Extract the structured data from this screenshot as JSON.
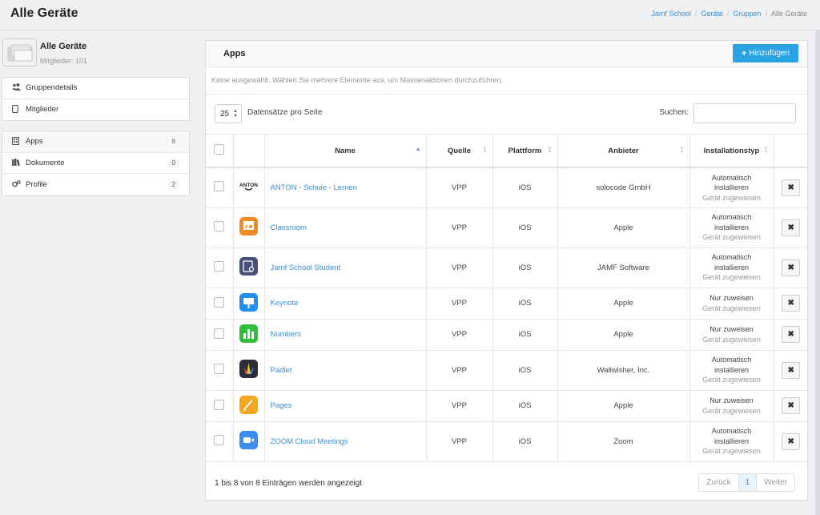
{
  "page": {
    "title": "Alle Geräte"
  },
  "breadcrumb": [
    "Jamf School",
    "Geräte",
    "Gruppen",
    "Alle Geräte"
  ],
  "group": {
    "name": "Alle Geräte",
    "members": "Mitglieder: 101"
  },
  "menu1": [
    {
      "label": "Gruppendetails",
      "icon": "users-icon"
    },
    {
      "label": "Mitglieder",
      "icon": "tablet-icon"
    }
  ],
  "menu2": [
    {
      "label": "Apps",
      "icon": "apps-icon",
      "count": "8"
    },
    {
      "label": "Dokumente",
      "icon": "books-icon",
      "count": "0"
    },
    {
      "label": "Profile",
      "icon": "gears-icon",
      "count": "2"
    }
  ],
  "apps_panel": {
    "title": "Apps",
    "add_label": "Hinzufügen",
    "info": "Keine ausgewählt. Wählen Sie mehrere Elemente aus, um Massenaktionen durchzuführen.",
    "page_size": "25",
    "page_size_label": "Datensätze pro Seite",
    "search_label": "Suchen:",
    "search_value": ""
  },
  "table": {
    "headers": {
      "name": "Name",
      "source": "Quelle",
      "platform": "Plattform",
      "vendor": "Anbieter",
      "install": "Installationstyp"
    },
    "rows": [
      {
        "name": "ANTON - Schule - Lernen",
        "source": "VPP",
        "platform": "iOS",
        "vendor": "solocode GmbH",
        "install": "Automatisch installieren",
        "assigned": "Gerät zugewiesen",
        "icon": "anton-icon",
        "color": "#ffffff"
      },
      {
        "name": "Classroom",
        "source": "VPP",
        "platform": "iOS",
        "vendor": "Apple",
        "install": "Automatisch installieren",
        "assigned": "Gerät zugewiesen",
        "icon": "classroom-icon",
        "color": "#f08a24"
      },
      {
        "name": "Jamf School Student",
        "source": "VPP",
        "platform": "iOS",
        "vendor": "JAMF Software",
        "install": "Automatisch installieren",
        "assigned": "Gerät zugewiesen",
        "icon": "jamf-student-icon",
        "color": "#4a4f7a"
      },
      {
        "name": "Keynote",
        "source": "VPP",
        "platform": "iOS",
        "vendor": "Apple",
        "install": "Nur zuweisen",
        "assigned": "Gerät zugewiesen",
        "icon": "keynote-icon",
        "color": "#1f8ff0"
      },
      {
        "name": "Numbers",
        "source": "VPP",
        "platform": "iOS",
        "vendor": "Apple",
        "install": "Nur zuweisen",
        "assigned": "Gerät zugewiesen",
        "icon": "numbers-icon",
        "color": "#2fbd3c"
      },
      {
        "name": "Padlet",
        "source": "VPP",
        "platform": "iOS",
        "vendor": "Wallwisher, Inc.",
        "install": "Automatisch installieren",
        "assigned": "Gerät zugewiesen",
        "icon": "padlet-icon",
        "color": "#2b2d3a"
      },
      {
        "name": "Pages",
        "source": "VPP",
        "platform": "iOS",
        "vendor": "Apple",
        "install": "Nur zuweisen",
        "assigned": "Gerät zugewiesen",
        "icon": "pages-icon",
        "color": "#f5a623"
      },
      {
        "name": "ZOOM Cloud Meetings",
        "source": "VPP",
        "platform": "iOS",
        "vendor": "Zoom",
        "install": "Automatisch installieren",
        "assigned": "Gerät zugewiesen",
        "icon": "zoom-icon",
        "color": "#3b8ef0"
      }
    ]
  },
  "footer": {
    "info": "1 bis 8 von 8 Einträgen werden angezeigt",
    "prev": "Zurück",
    "current": "1",
    "next": "Weiter"
  },
  "colors": {
    "accent": "#2aa2e4",
    "link": "#3a8fd6"
  }
}
